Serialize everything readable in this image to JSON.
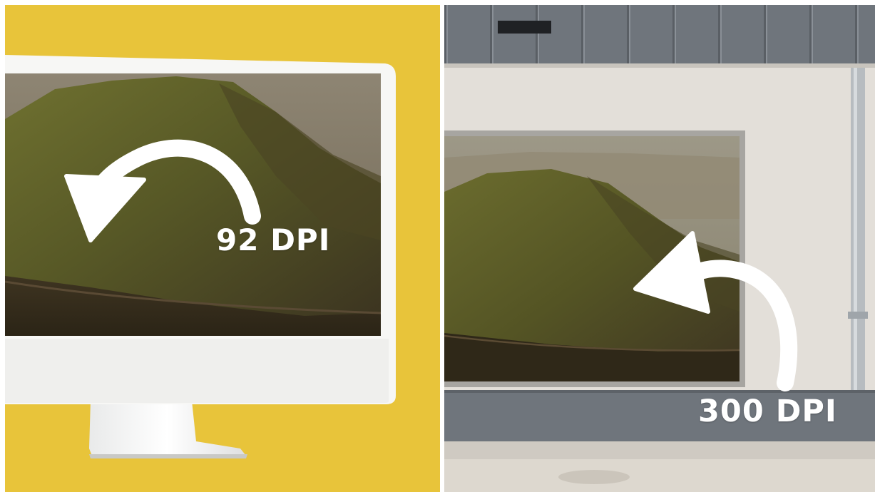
{
  "left": {
    "label": "92 DPI",
    "background_color": "#E8C43A",
    "monitor_color": "#F7F7F5"
  },
  "right": {
    "label": "300 DPI",
    "wall_color": "#E6E3DE",
    "cladding_color": "#6F757C"
  },
  "arrow_color": "#FFFFFF"
}
